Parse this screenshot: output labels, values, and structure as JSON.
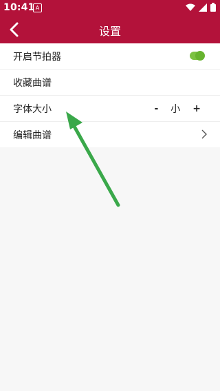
{
  "status": {
    "time": "10:41",
    "notif_icon": "A"
  },
  "header": {
    "title": "设置"
  },
  "settings": {
    "metronome_label": "开启节拍器",
    "metronome_on": true,
    "favorites_label": "收藏曲谱",
    "font_size_label": "字体大小",
    "font_decrease": "-",
    "font_size_value": "小",
    "font_increase": "+",
    "edit_label": "编辑曲谱"
  },
  "colors": {
    "header": "#b3123a",
    "toggle": "#7cc242",
    "arrow": "#3aa84a"
  }
}
